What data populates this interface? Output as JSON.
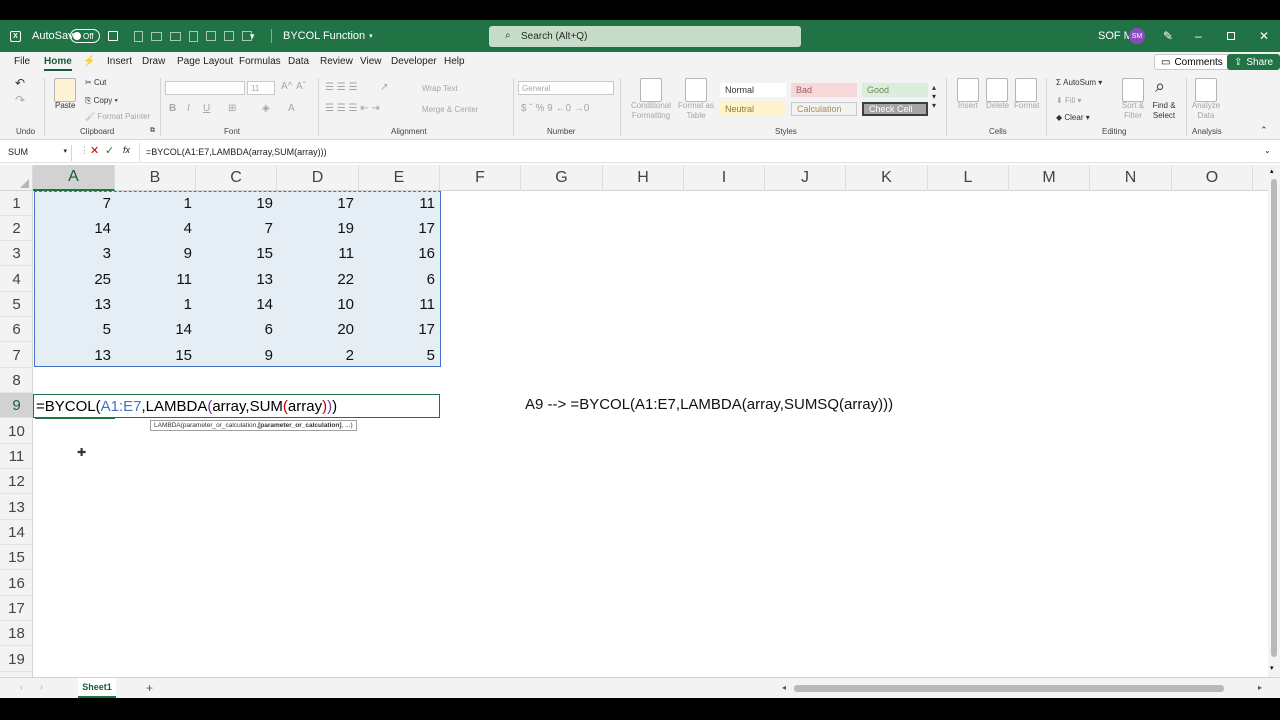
{
  "titlebar": {
    "autosave_label": "AutoSave",
    "autosave_state": "Off",
    "doc_title": "BYCOL Function",
    "search_placeholder": "Search (Alt+Q)",
    "user_name": "SOF M",
    "user_initials": "SM"
  },
  "menu": {
    "items": [
      "File",
      "Home",
      "Insert",
      "Draw",
      "Page Layout",
      "Formulas",
      "Data",
      "Review",
      "View",
      "Developer",
      "Help"
    ],
    "active": "Home",
    "comments_label": "Comments",
    "share_label": "Share"
  },
  "ribbon": {
    "clipboard": {
      "paste": "Paste",
      "cut": "Cut",
      "copy": "Copy",
      "format_painter": "Format Painter",
      "label": "Clipboard"
    },
    "undo_label": "Undo",
    "font": {
      "size": "11",
      "label": "Font"
    },
    "alignment": {
      "wrap": "Wrap Text",
      "merge": "Merge & Center",
      "label": "Alignment"
    },
    "number": {
      "format": "General",
      "label": "Number"
    },
    "styles": {
      "conditional": "Conditional Formatting",
      "format_table": "Format as Table",
      "cells": [
        "Normal",
        "Bad",
        "Good",
        "Neutral",
        "Calculation",
        "Check Cell"
      ],
      "label": "Styles"
    },
    "cells": {
      "insert": "Insert",
      "delete": "Delete",
      "format": "Format",
      "label": "Cells"
    },
    "editing": {
      "autosum": "AutoSum",
      "fill": "Fill",
      "clear": "Clear",
      "sort": "Sort & Filter",
      "find": "Find & Select",
      "label": "Editing"
    },
    "analysis": {
      "analyze": "Analyze Data",
      "label": "Analysis"
    }
  },
  "formula_bar": {
    "name_box": "SUM",
    "fx": "fx",
    "formula": "=BYCOL(A1:E7,LAMBDA(array,SUM(array)))"
  },
  "grid": {
    "columns": [
      "A",
      "B",
      "C",
      "D",
      "E",
      "F",
      "G",
      "H",
      "I",
      "J",
      "K",
      "L",
      "M",
      "N",
      "O"
    ],
    "rows": [
      "1",
      "2",
      "3",
      "4",
      "5",
      "6",
      "7",
      "8",
      "9",
      "10",
      "11",
      "12",
      "13",
      "14",
      "15",
      "16",
      "17",
      "18",
      "19"
    ],
    "data": [
      [
        "7",
        "1",
        "19",
        "17",
        "11"
      ],
      [
        "14",
        "4",
        "7",
        "19",
        "17"
      ],
      [
        "3",
        "9",
        "15",
        "11",
        "16"
      ],
      [
        "25",
        "11",
        "13",
        "22",
        "6"
      ],
      [
        "13",
        "1",
        "14",
        "10",
        "11"
      ],
      [
        "5",
        "14",
        "6",
        "20",
        "17"
      ],
      [
        "13",
        "15",
        "9",
        "2",
        "5"
      ]
    ],
    "edit_parts": [
      "=BYCOL(",
      "A1:E7",
      ",LAMBDA",
      "(",
      "array,SUM",
      "(",
      "array",
      ")",
      ")",
      ")"
    ],
    "tooltip_plain": "LAMBDA(parameter_or_calculation, ",
    "tooltip_bold": "[parameter_or_calculation]",
    "tooltip_end": ", ...)",
    "note": "A9 -->  =BYCOL(A1:E7,LAMBDA(array,SUMSQ(array)))"
  },
  "sheets": {
    "tabs": [
      "Sheet1"
    ],
    "add": "+"
  },
  "colors": {
    "brand": "#217346",
    "selection_fill": "#e6eef5",
    "ref_blue": "#4472c4",
    "paren_purple": "#7030a0",
    "paren_red": "#c00000"
  }
}
